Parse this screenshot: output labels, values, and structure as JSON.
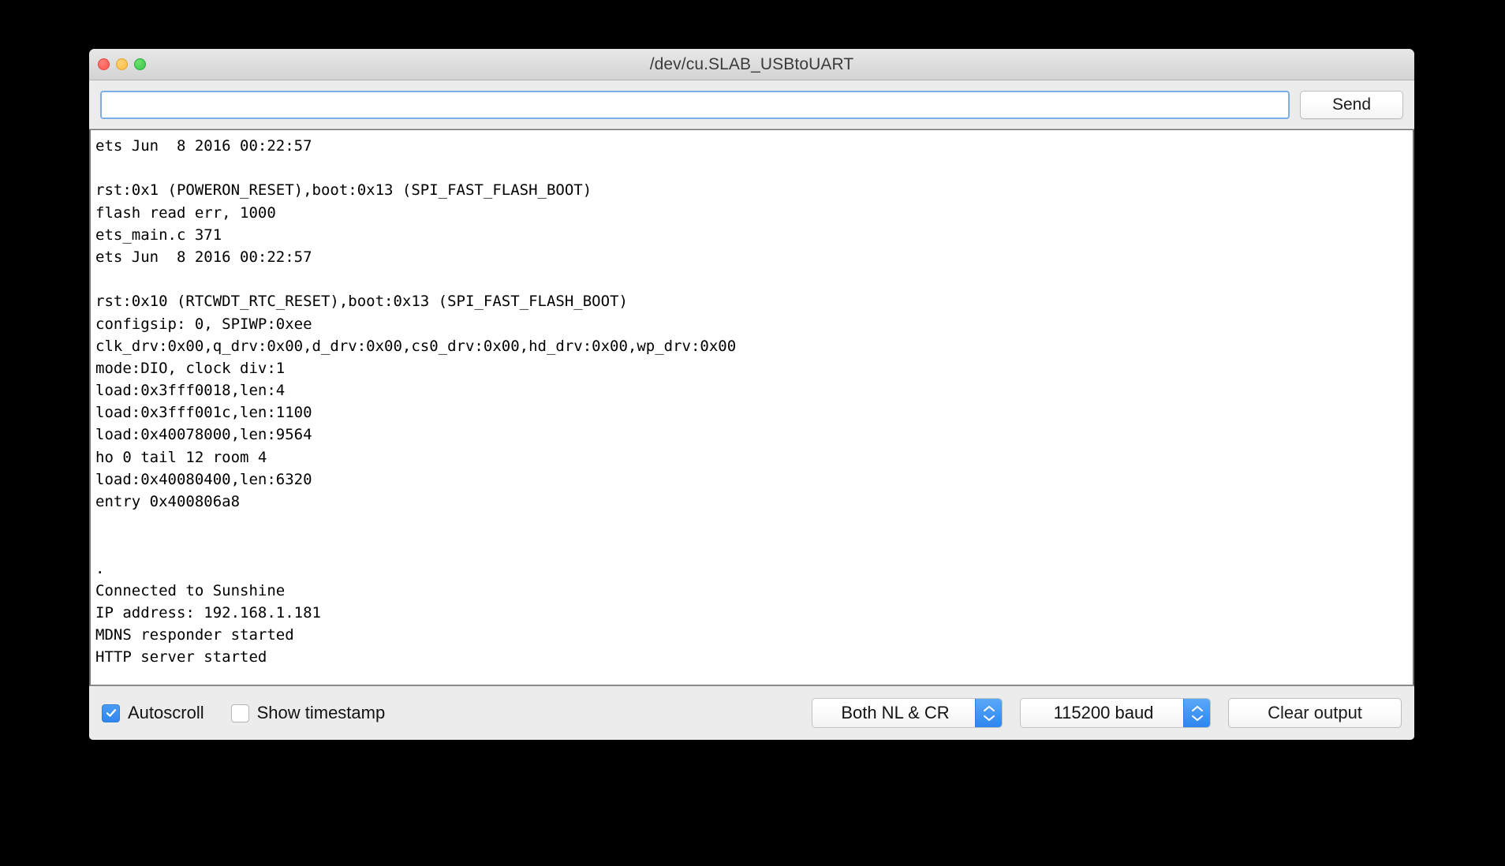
{
  "window": {
    "title": "/dev/cu.SLAB_USBtoUART",
    "traffic_lights": {
      "close": "close-button",
      "minimize": "minimize-button",
      "zoom": "zoom-button"
    },
    "colors": {
      "close": "#f9564d",
      "minimize": "#fdbc40",
      "zoom": "#34c749",
      "accent_blue": "#2d86ef",
      "input_focus_border": "#7daee4",
      "chrome": "#ececec",
      "console_bg": "#ffffff",
      "console_text": "#000000"
    }
  },
  "send_bar": {
    "input_value": "",
    "input_placeholder": "",
    "send_label": "Send"
  },
  "console": {
    "lines": [
      "ets Jun  8 2016 00:22:57",
      "",
      "rst:0x1 (POWERON_RESET),boot:0x13 (SPI_FAST_FLASH_BOOT)",
      "flash read err, 1000",
      "ets_main.c 371",
      "ets Jun  8 2016 00:22:57",
      "",
      "rst:0x10 (RTCWDT_RTC_RESET),boot:0x13 (SPI_FAST_FLASH_BOOT)",
      "configsip: 0, SPIWP:0xee",
      "clk_drv:0x00,q_drv:0x00,d_drv:0x00,cs0_drv:0x00,hd_drv:0x00,wp_drv:0x00",
      "mode:DIO, clock div:1",
      "load:0x3fff0018,len:4",
      "load:0x3fff001c,len:1100",
      "load:0x40078000,len:9564",
      "ho 0 tail 12 room 4",
      "load:0x40080400,len:6320",
      "entry 0x400806a8",
      "",
      "",
      ".",
      "Connected to Sunshine",
      "IP address: 192.168.1.181",
      "MDNS responder started",
      "HTTP server started"
    ]
  },
  "bottom_bar": {
    "autoscroll": {
      "label": "Autoscroll",
      "checked": true
    },
    "show_timestamp": {
      "label": "Show timestamp",
      "checked": false
    },
    "line_ending": {
      "selected": "Both NL & CR"
    },
    "baud_rate": {
      "selected": "115200 baud"
    },
    "clear_output_label": "Clear output"
  }
}
